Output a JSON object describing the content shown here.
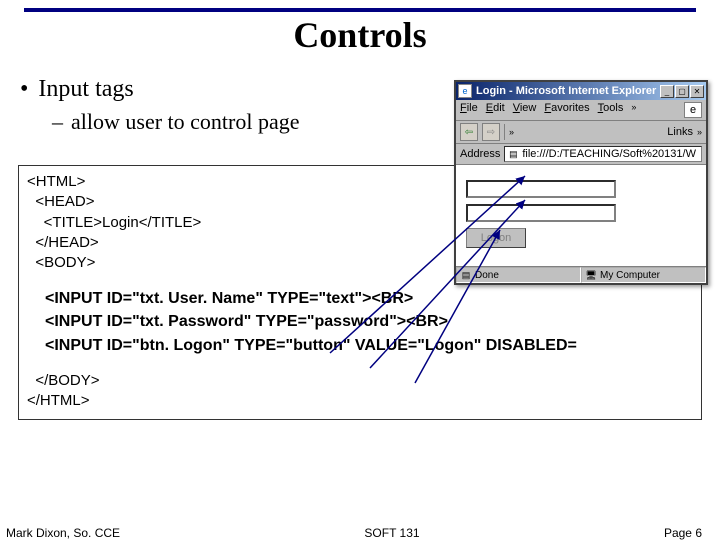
{
  "title": "Controls",
  "bullet": {
    "dot": "•",
    "text": "Input tags"
  },
  "sub": {
    "dash": "–",
    "text": "allow user to control page"
  },
  "code": {
    "l1": "<HTML>",
    "l2": "  <HEAD>",
    "l3": "    <TITLE>Login</TITLE>",
    "l4": "  </HEAD>",
    "l5": "  <BODY>",
    "b1": "<INPUT ID=\"txt. User. Name\" TYPE=\"text\"><BR>",
    "b2": "<INPUT ID=\"txt. Password\" TYPE=\"password\"><BR>",
    "b3": "<INPUT ID=\"btn. Logon\"   TYPE=\"button\" VALUE=\"Logon\" DISABLED=",
    "t1": "  </BODY>",
    "t2": "</HTML>"
  },
  "browser": {
    "title": "Login - Microsoft Internet Explorer",
    "menu": [
      "File",
      "Edit",
      "View",
      "Favorites",
      "Tools"
    ],
    "chev": "»",
    "ieLogo": "e",
    "links": "Links",
    "addrLabel": "Address",
    "addrValue": "file:///D:/TEACHING/Soft%20131/W",
    "logonLabel": "Logon",
    "statusDone": "Done",
    "statusZone": "My Computer",
    "minGlyph": "_",
    "maxGlyph": "▢",
    "closeGlyph": "✕",
    "backGlyph": "⇦",
    "fwdGlyph": "⇨",
    "docGlyph": "▤",
    "pcGlyph": "🖥"
  },
  "footer": {
    "left": "Mark Dixon, So. CCE",
    "center": "SOFT 131",
    "right": "Page 6"
  }
}
